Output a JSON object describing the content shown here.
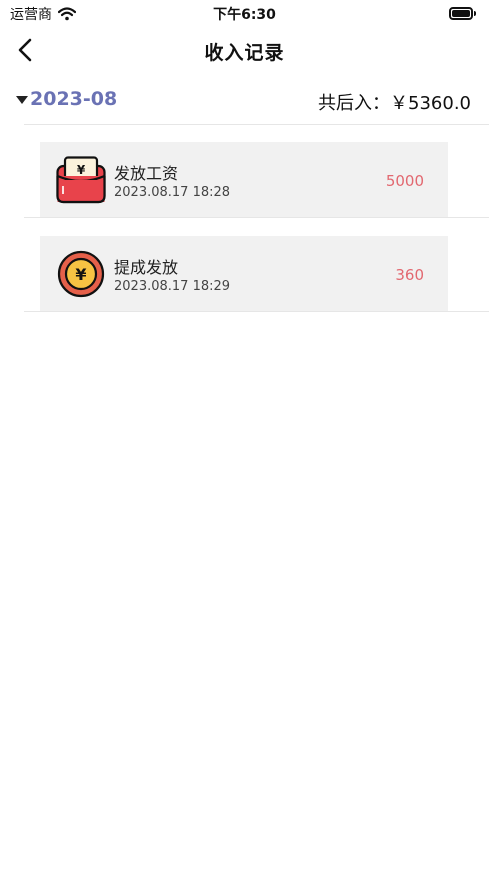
{
  "status_bar": {
    "carrier": "运营商",
    "time": "下午6:30"
  },
  "nav": {
    "title": "收入记录"
  },
  "month": {
    "label": "2023-08",
    "total": "共后入：￥5360.0"
  },
  "records": [
    {
      "title": "发放工资",
      "time": "2023.08.17 18:28",
      "amount": "5000",
      "icon": "red-envelope-icon"
    },
    {
      "title": "提成发放",
      "time": "2023.08.17 18:29",
      "amount": "360",
      "icon": "yuan-coin-icon"
    }
  ],
  "colors": {
    "month_accent": "#6a72b4",
    "amount": "#e26870",
    "card_bg": "#f1f1f1"
  }
}
